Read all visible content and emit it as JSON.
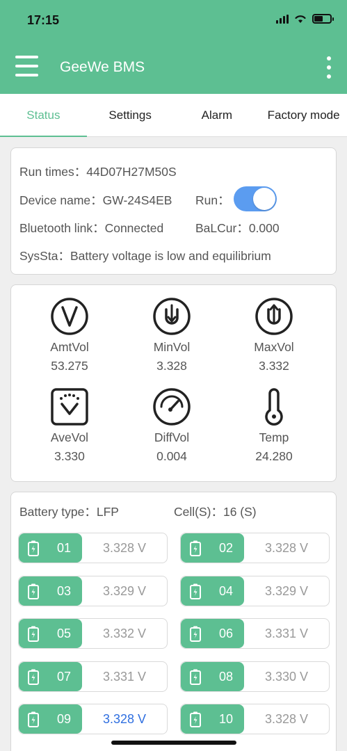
{
  "status_bar": {
    "time": "17:15"
  },
  "app_bar": {
    "title": "GeeWe BMS"
  },
  "tabs": [
    {
      "label": "Status"
    },
    {
      "label": "Settings"
    },
    {
      "label": "Alarm"
    },
    {
      "label": "Factory mode"
    }
  ],
  "info": {
    "run_times": "Run times：44D07H27M50S",
    "device_name": "Device name：GW-24S4EB",
    "run_label": "Run：",
    "run_on": true,
    "bluetooth": "Bluetooth link：Connected",
    "balcur": "BaLCur：0.000",
    "syssta": "SysSta：Battery voltage is low and equilibrium"
  },
  "stats": {
    "amt": {
      "label": "AmtVol",
      "value": "53.275",
      "icon": "voltage-icon"
    },
    "min": {
      "label": "MinVol",
      "value": "3.328",
      "icon": "down-arrow-icon"
    },
    "max": {
      "label": "MaxVol",
      "value": "3.332",
      "icon": "up-arrow-icon"
    },
    "ave": {
      "label": "AveVol",
      "value": "3.330",
      "icon": "meter-icon"
    },
    "diff": {
      "label": "DiffVol",
      "value": "0.004",
      "icon": "gauge-icon"
    },
    "temp": {
      "label": "Temp",
      "value": "24.280",
      "icon": "thermometer-icon"
    }
  },
  "cells_header": {
    "battery_type": "Battery type：LFP",
    "cell_count": "Cell(S)：16 (S)"
  },
  "cells": [
    {
      "num": "01",
      "volt": "3.328 V"
    },
    {
      "num": "02",
      "volt": "3.328 V"
    },
    {
      "num": "03",
      "volt": "3.329 V"
    },
    {
      "num": "04",
      "volt": "3.329 V"
    },
    {
      "num": "05",
      "volt": "3.332 V"
    },
    {
      "num": "06",
      "volt": "3.331 V"
    },
    {
      "num": "07",
      "volt": "3.331 V"
    },
    {
      "num": "08",
      "volt": "3.330 V"
    },
    {
      "num": "09",
      "volt": "3.328 V",
      "highlight": true
    },
    {
      "num": "10",
      "volt": "3.328 V"
    }
  ],
  "colors": {
    "accent": "#5dbf92",
    "toggle": "#5b9cf0",
    "highlight": "#2f6fe0"
  }
}
